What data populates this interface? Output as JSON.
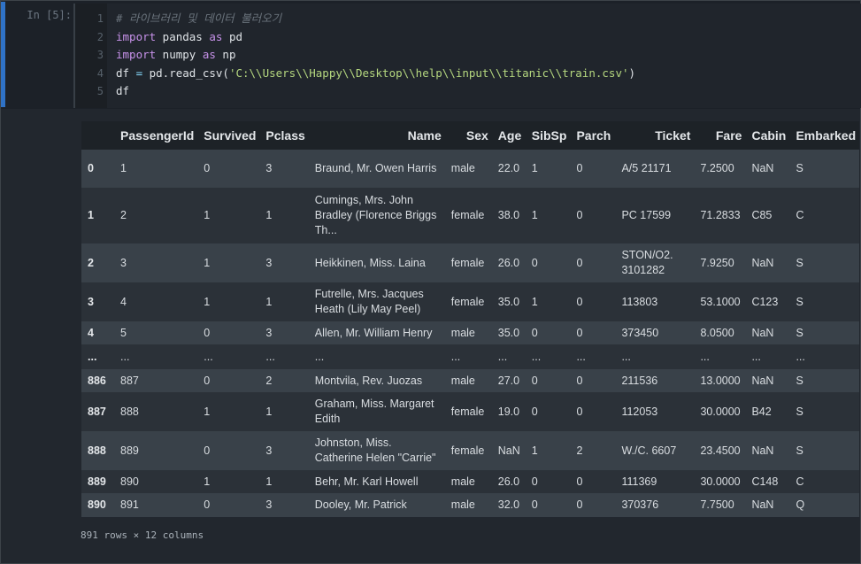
{
  "cell": {
    "prompt": "In [5]:",
    "line_numbers": [
      "1",
      "2",
      "3",
      "4",
      "5"
    ],
    "code": {
      "line1_comment": "# 라이브러리 및 데이터 불러오기",
      "line2": {
        "kw1": "import",
        "mod": " pandas ",
        "kw2": "as",
        "alias": " pd"
      },
      "line3": {
        "kw1": "import",
        "mod": " numpy ",
        "kw2": "as",
        "alias": " np"
      },
      "line4": {
        "lhs": "df ",
        "eq": "=",
        "call": " pd.read_csv(",
        "path": "'C:\\\\Users\\\\Happy\\\\Desktop\\\\help\\\\input\\\\titanic\\\\train.csv'",
        "close": ")"
      },
      "line5": "df"
    }
  },
  "output": {
    "columns": [
      "",
      "PassengerId",
      "Survived",
      "Pclass",
      "Name",
      "Sex",
      "Age",
      "SibSp",
      "Parch",
      "Ticket",
      "Fare",
      "Cabin",
      "Embarked"
    ],
    "rows": [
      {
        "idx": "0",
        "cells": [
          "1",
          "0",
          "3",
          "Braund, Mr. Owen Harris",
          "male",
          "22.0",
          "1",
          "0",
          "A/5 21171",
          "7.2500",
          "NaN",
          "S"
        ]
      },
      {
        "idx": "1",
        "cells": [
          "2",
          "1",
          "1",
          "Cumings, Mrs. John Bradley (Florence Briggs Th...",
          "female",
          "38.0",
          "1",
          "0",
          "PC 17599",
          "71.2833",
          "C85",
          "C"
        ]
      },
      {
        "idx": "2",
        "cells": [
          "3",
          "1",
          "3",
          "Heikkinen, Miss. Laina",
          "female",
          "26.0",
          "0",
          "0",
          "STON/O2. 3101282",
          "7.9250",
          "NaN",
          "S"
        ]
      },
      {
        "idx": "3",
        "cells": [
          "4",
          "1",
          "1",
          "Futrelle, Mrs. Jacques Heath (Lily May Peel)",
          "female",
          "35.0",
          "1",
          "0",
          "113803",
          "53.1000",
          "C123",
          "S"
        ]
      },
      {
        "idx": "4",
        "cells": [
          "5",
          "0",
          "3",
          "Allen, Mr. William Henry",
          "male",
          "35.0",
          "0",
          "0",
          "373450",
          "8.0500",
          "NaN",
          "S"
        ]
      },
      {
        "idx": "...",
        "cells": [
          "...",
          "...",
          "...",
          "...",
          "...",
          "...",
          "...",
          "...",
          "...",
          "...",
          "...",
          "..."
        ]
      },
      {
        "idx": "886",
        "cells": [
          "887",
          "0",
          "2",
          "Montvila, Rev. Juozas",
          "male",
          "27.0",
          "0",
          "0",
          "211536",
          "13.0000",
          "NaN",
          "S"
        ]
      },
      {
        "idx": "887",
        "cells": [
          "888",
          "1",
          "1",
          "Graham, Miss. Margaret Edith",
          "female",
          "19.0",
          "0",
          "0",
          "112053",
          "30.0000",
          "B42",
          "S"
        ]
      },
      {
        "idx": "888",
        "cells": [
          "889",
          "0",
          "3",
          "Johnston, Miss. Catherine Helen \"Carrie\"",
          "female",
          "NaN",
          "1",
          "2",
          "W./C. 6607",
          "23.4500",
          "NaN",
          "S"
        ]
      },
      {
        "idx": "889",
        "cells": [
          "890",
          "1",
          "1",
          "Behr, Mr. Karl Howell",
          "male",
          "26.0",
          "0",
          "0",
          "111369",
          "30.0000",
          "C148",
          "C"
        ]
      },
      {
        "idx": "890",
        "cells": [
          "891",
          "0",
          "3",
          "Dooley, Mr. Patrick",
          "male",
          "32.0",
          "0",
          "0",
          "370376",
          "7.7500",
          "NaN",
          "Q"
        ]
      }
    ],
    "summary": "891 rows × 12 columns"
  },
  "colors": {
    "active_cell_bar": "#2f72c6",
    "background": "#22272e",
    "row_odd": "#394149",
    "row_even": "#2b3138"
  }
}
